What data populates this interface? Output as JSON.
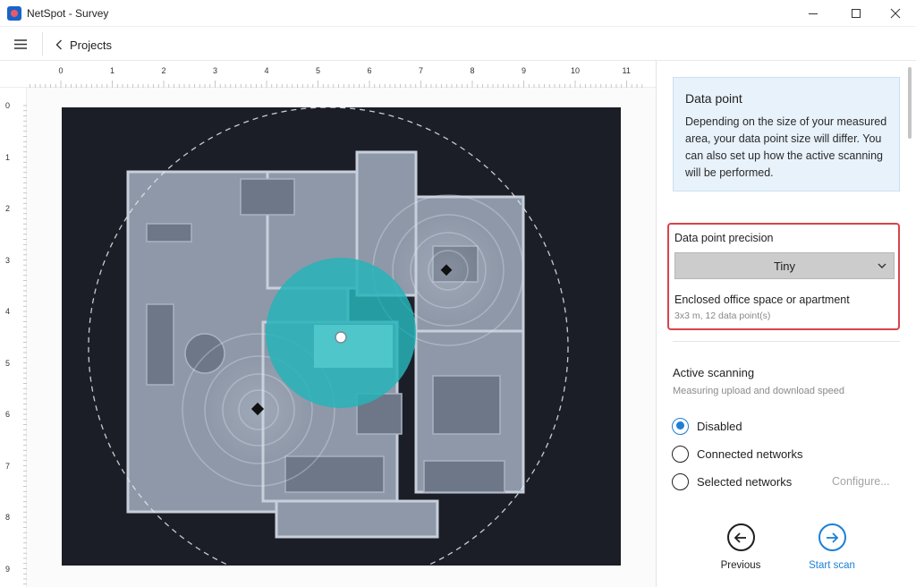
{
  "window": {
    "title": "NetSpot - Survey",
    "icon": "netspot-app-icon"
  },
  "toolbar": {
    "menu_icon": "hamburger-menu-icon",
    "back_label": "Projects"
  },
  "ruler": {
    "x_labels": [
      "0",
      "1",
      "2",
      "3",
      "4",
      "5",
      "6",
      "7",
      "8",
      "9",
      "10",
      "11"
    ],
    "y_labels": [
      "0",
      "1",
      "2",
      "3",
      "4",
      "5",
      "6",
      "7",
      "8",
      "9"
    ]
  },
  "map": {
    "background": "#1b1e26",
    "coverage_color": "#27b3b8"
  },
  "info": {
    "title": "Data point",
    "text": "Depending on the size of your measured area, your data point size will differ. You can also set up how the active scanning will be performed."
  },
  "precision": {
    "label": "Data point precision",
    "selected": "Tiny",
    "area_title": "Enclosed office space or apartment",
    "area_sub": "3x3 m, 12 data point(s)"
  },
  "scanning": {
    "title": "Active scanning",
    "subtitle": "Measuring upload and download speed",
    "options": [
      {
        "label": "Disabled",
        "checked": true
      },
      {
        "label": "Connected networks",
        "checked": false
      },
      {
        "label": "Selected networks",
        "checked": false
      }
    ],
    "configure_label": "Configure..."
  },
  "nav": {
    "previous_label": "Previous",
    "start_label": "Start scan"
  },
  "colors": {
    "accent": "#1e7fd6",
    "highlight_border": "#d9434b",
    "info_bg": "#e8f2fb"
  }
}
